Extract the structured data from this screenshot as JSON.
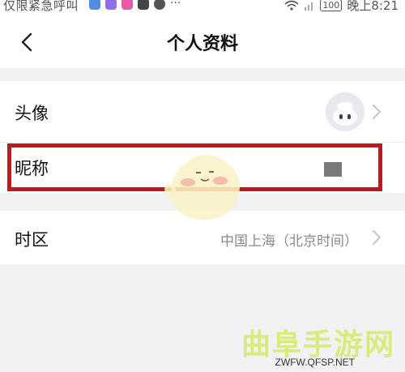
{
  "status_bar": {
    "left_text": "仅限紧急呼叫",
    "dots": "···",
    "battery": "100",
    "time": "晚上8:21"
  },
  "header": {
    "title": "个人资料",
    "back_icon": "chevron-left-icon"
  },
  "rows": {
    "avatar_label": "头像",
    "nickname_label": "昵称",
    "timezone_label": "时区",
    "timezone_value": "中国上海（北京时间）"
  },
  "watermark": {
    "title": "曲阜手游网",
    "url": "ZWFW.QFSP.NET"
  },
  "colors": {
    "highlight": "#c0161f",
    "background": "#f2f2f4"
  }
}
